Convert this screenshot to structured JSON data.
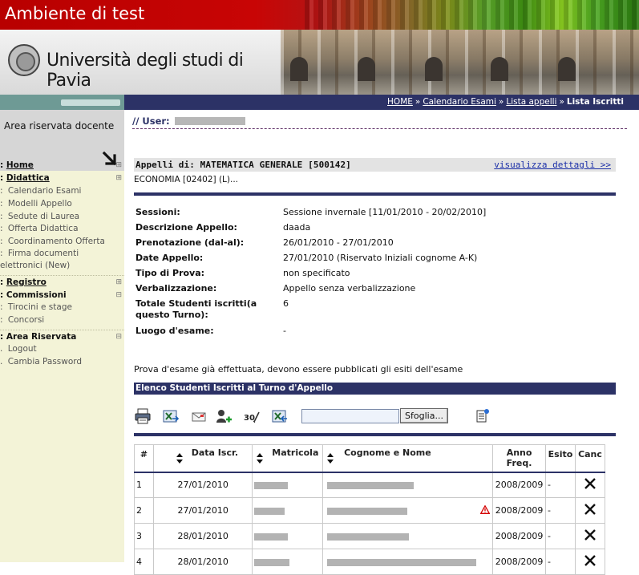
{
  "env_title": "Ambiente di test",
  "university": "Università degli studi di Pavia",
  "sidebar": {
    "reserved_label": "Area riservata docente",
    "items": [
      {
        "label": "Home",
        "style": "bold-ul",
        "expander": "⊞"
      },
      {
        "label": "Didattica",
        "style": "bold-ul",
        "expander": "⊞"
      },
      {
        "label": "Calendario Esami",
        "style": "sub"
      },
      {
        "label": "Modelli Appello",
        "style": "sub"
      },
      {
        "label": "Sedute di Laurea",
        "style": "sub"
      },
      {
        "label": "Offerta Didattica",
        "style": "sub"
      },
      {
        "label": "Coordinamento Offerta",
        "style": "sub"
      },
      {
        "label": "Firma documenti",
        "style": "sub"
      },
      {
        "label": "elettronici (New)",
        "style": "sub"
      },
      {
        "label": "Registro",
        "style": "bold-ul",
        "expander": "⊞"
      },
      {
        "label": "Commissioni",
        "style": "bold",
        "expander": "⊟"
      },
      {
        "label": "Tirocini e stage",
        "style": "sub"
      },
      {
        "label": "Concorsi",
        "style": "sub"
      },
      {
        "label": "Area Riservata",
        "style": "bold",
        "expander": "⊟"
      },
      {
        "label": "Logout",
        "style": "sub"
      },
      {
        "label": "Cambia Password",
        "style": "sub"
      }
    ]
  },
  "breadcrumb": {
    "items": [
      "HOME",
      "Calendario Esami",
      "Lista appelli"
    ],
    "current": "Lista Iscritti",
    "separator": "»"
  },
  "user_label": "// User:",
  "appelli": {
    "title": "Appelli di: MATEMATICA GENERALE [500142]",
    "details_link": "visualizza dettagli >>",
    "subtitle": "ECONOMIA [02402] (L)..."
  },
  "info": [
    {
      "label": "Sessioni:",
      "value": "Sessione invernale [11/01/2010 - 20/02/2010]"
    },
    {
      "label": "Descrizione Appello:",
      "value": "daada"
    },
    {
      "label": "Prenotazione (dal-al):",
      "value": "26/01/2010 - 27/01/2010"
    },
    {
      "label": "Date Appello:",
      "value": "27/01/2010 (Riservato Iniziali cognome A-K)"
    },
    {
      "label": "Tipo di Prova:",
      "value": "non specificato"
    },
    {
      "label": "Verbalizzazione:",
      "value": "Appello senza verbalizzazione"
    },
    {
      "label": "Totale Studenti iscritti(a",
      "label2": "questo Turno):",
      "value": "6"
    },
    {
      "label": "Luogo d'esame:",
      "value": "-"
    }
  ],
  "prova_note": "Prova d'esame già effettuata, devono essere pubblicati gli esiti dell'esame",
  "list_header": "Elenco Studenti Iscritti al Turno d'Appello",
  "toolbar": {
    "browse_label": "Sfoglia...",
    "file_value": ""
  },
  "table": {
    "headers": {
      "num": "#",
      "date": "Data Iscr.",
      "matricola": "Matricola",
      "name": "Cognome e Nome",
      "year_line1": "Anno",
      "year_line2": "Freq.",
      "esito": "Esito",
      "canc": "Canc"
    },
    "rows": [
      {
        "num": "1",
        "date": "27/01/2010",
        "year": "2008/2009",
        "esito": "-",
        "warning": false
      },
      {
        "num": "2",
        "date": "27/01/2010",
        "year": "2008/2009",
        "esito": "-",
        "warning": true
      },
      {
        "num": "3",
        "date": "28/01/2010",
        "year": "2008/2009",
        "esito": "-",
        "warning": false
      },
      {
        "num": "4",
        "date": "28/01/2010",
        "year": "2008/2009",
        "esito": "-",
        "warning": false
      }
    ]
  },
  "colors": {
    "navy": "#2c3266",
    "sidebar_bg": "#f3f3d7",
    "teal": "#6e9a95",
    "link": "#1b2fa8",
    "warning": "#d40000"
  }
}
